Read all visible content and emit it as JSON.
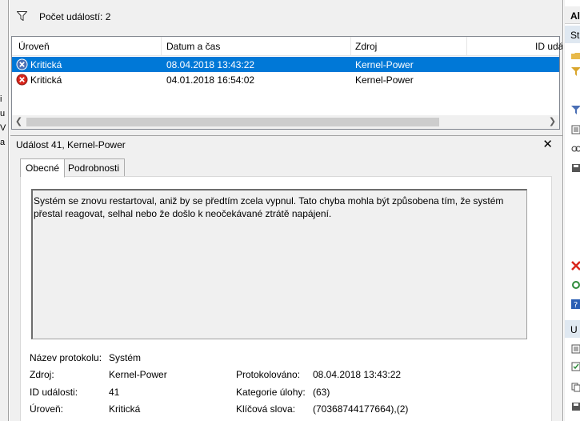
{
  "left_strip_fragments": [
    "i",
    "u",
    "V",
    "a"
  ],
  "filter_bar": {
    "count_label": "Počet událostí: 2",
    "icon": "filter-icon"
  },
  "event_list": {
    "columns": [
      "Úroveň",
      "Datum a čas",
      "Zdroj",
      "ID udá"
    ],
    "rows": [
      {
        "level": "Kritická",
        "datetime": "08.04.2018 13:43:22",
        "source": "Kernel-Power",
        "selected": true,
        "icon": "critical-error-icon"
      },
      {
        "level": "Kritická",
        "datetime": "04.01.2018 16:54:02",
        "source": "Kernel-Power",
        "selected": false,
        "icon": "critical-error-icon"
      }
    ],
    "selection_color": "#0078d7"
  },
  "details": {
    "title": "Událost 41, Kernel-Power",
    "tabs": [
      "Obecné",
      "Podrobnosti"
    ],
    "active_tab": "Obecné",
    "description": "Systém se znovu restartoval, aniž by se předtím zcela vypnul. Tato chyba mohla být způsobena tím, že systém přestal reagovat, selhal nebo že došlo k neočekávané ztrátě napájení.",
    "props": {
      "log_name_label": "Název protokolu:",
      "log_name_value": "Systém",
      "source_label": "Zdroj:",
      "source_value": "Kernel-Power",
      "logged_label": "Protokolováno:",
      "logged_value": "08.04.2018 13:43:22",
      "event_id_label": "ID události:",
      "event_id_value": "41",
      "task_category_label": "Kategorie úlohy:",
      "task_category_value": "(63)",
      "level_label": "Úroveň:",
      "level_value": "Kritická",
      "keywords_label": "Klíčová slova:",
      "keywords_value": "(70368744177664),(2)"
    }
  },
  "right_pane": {
    "header": "Al",
    "section1": "St",
    "section2": "U"
  }
}
